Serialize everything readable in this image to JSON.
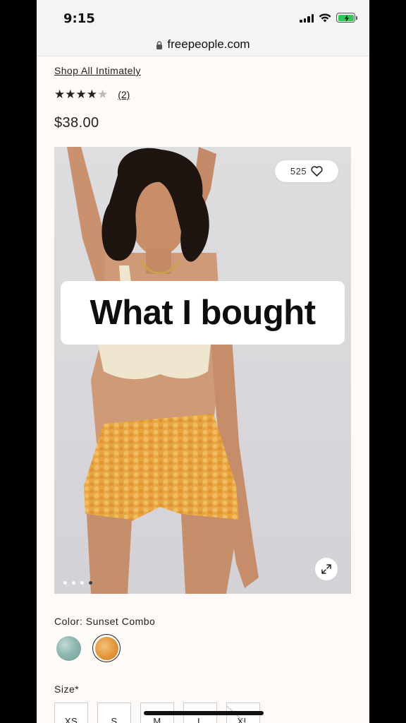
{
  "status_bar": {
    "time": "9:15"
  },
  "browser": {
    "url": "freepeople.com"
  },
  "product": {
    "shop_link": "Shop All Intimately",
    "stars_filled": "★★★★",
    "stars_empty": "★",
    "rating_value": 4,
    "rating_max": 5,
    "review_count": "(2)",
    "price": "$38.00"
  },
  "image": {
    "like_count": "525",
    "overlay_caption": "What I bought",
    "carousel_total": 4,
    "carousel_active": 4
  },
  "color": {
    "label": "Color: Sunset Combo",
    "swatches": [
      {
        "name": "blue-swatch",
        "color": "#8fb7b1",
        "selected": false
      },
      {
        "name": "sunset-combo-swatch",
        "color": "#e49a3f",
        "selected": true
      }
    ]
  },
  "size": {
    "label": "Size*",
    "options": [
      {
        "label": "XS",
        "available": true
      },
      {
        "label": "S",
        "available": true
      },
      {
        "label": "M",
        "available": true
      },
      {
        "label": "L",
        "available": true
      },
      {
        "label": "XL",
        "available": false
      }
    ]
  },
  "colors": {
    "background": "#fdfaf7",
    "text": "#222222",
    "battery": "#32c759"
  }
}
